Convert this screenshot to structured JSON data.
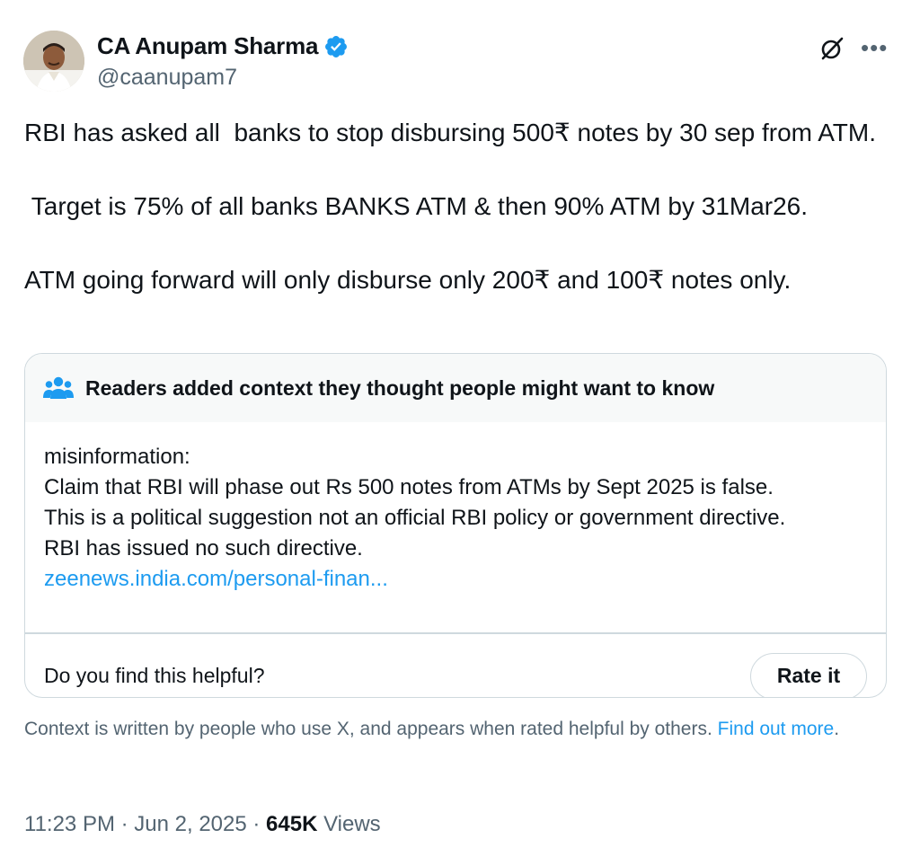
{
  "author": {
    "name": "CA Anupam Sharma",
    "handle": "@caanupam7",
    "verified": true,
    "verified_color": "#1d9bf0"
  },
  "tweet": {
    "lines": [
      "RBI has asked all  banks to stop disbursing 500₹ notes by 30 sep from ATM.",
      " Target is 75% of all banks BANKS ATM & then 90% ATM by 31Mar26.",
      "ATM going forward will only disburse only 200₹ and 100₹ notes only."
    ]
  },
  "community_note": {
    "header": "Readers added context they thought people might want to know",
    "body_lines": [
      "misinformation:",
      "Claim that RBI will phase out Rs 500 notes from ATMs by Sept 2025 is false.",
      "This is a political suggestion not an official RBI policy or government directive.",
      "RBI has issued no such directive."
    ],
    "link_text": "zeenews.india.com/personal-finan...",
    "helpful_question": "Do you find this helpful?",
    "rate_button": "Rate it"
  },
  "context_footer": {
    "text": "Context is written by people who use X, and appears when rated helpful by others. ",
    "link_text": "Find out more",
    "suffix": "."
  },
  "meta": {
    "time": "11:23 PM",
    "separator": " · ",
    "date": "Jun 2, 2025",
    "views_count": "645K",
    "views_label": " Views"
  },
  "icons": {
    "grok": "grok-icon",
    "more": "more-icon",
    "people": "people-icon",
    "verified": "verified-badge-icon"
  },
  "colors": {
    "link": "#1d9bf0",
    "secondary_text": "#536471",
    "border": "#cfd9de"
  }
}
